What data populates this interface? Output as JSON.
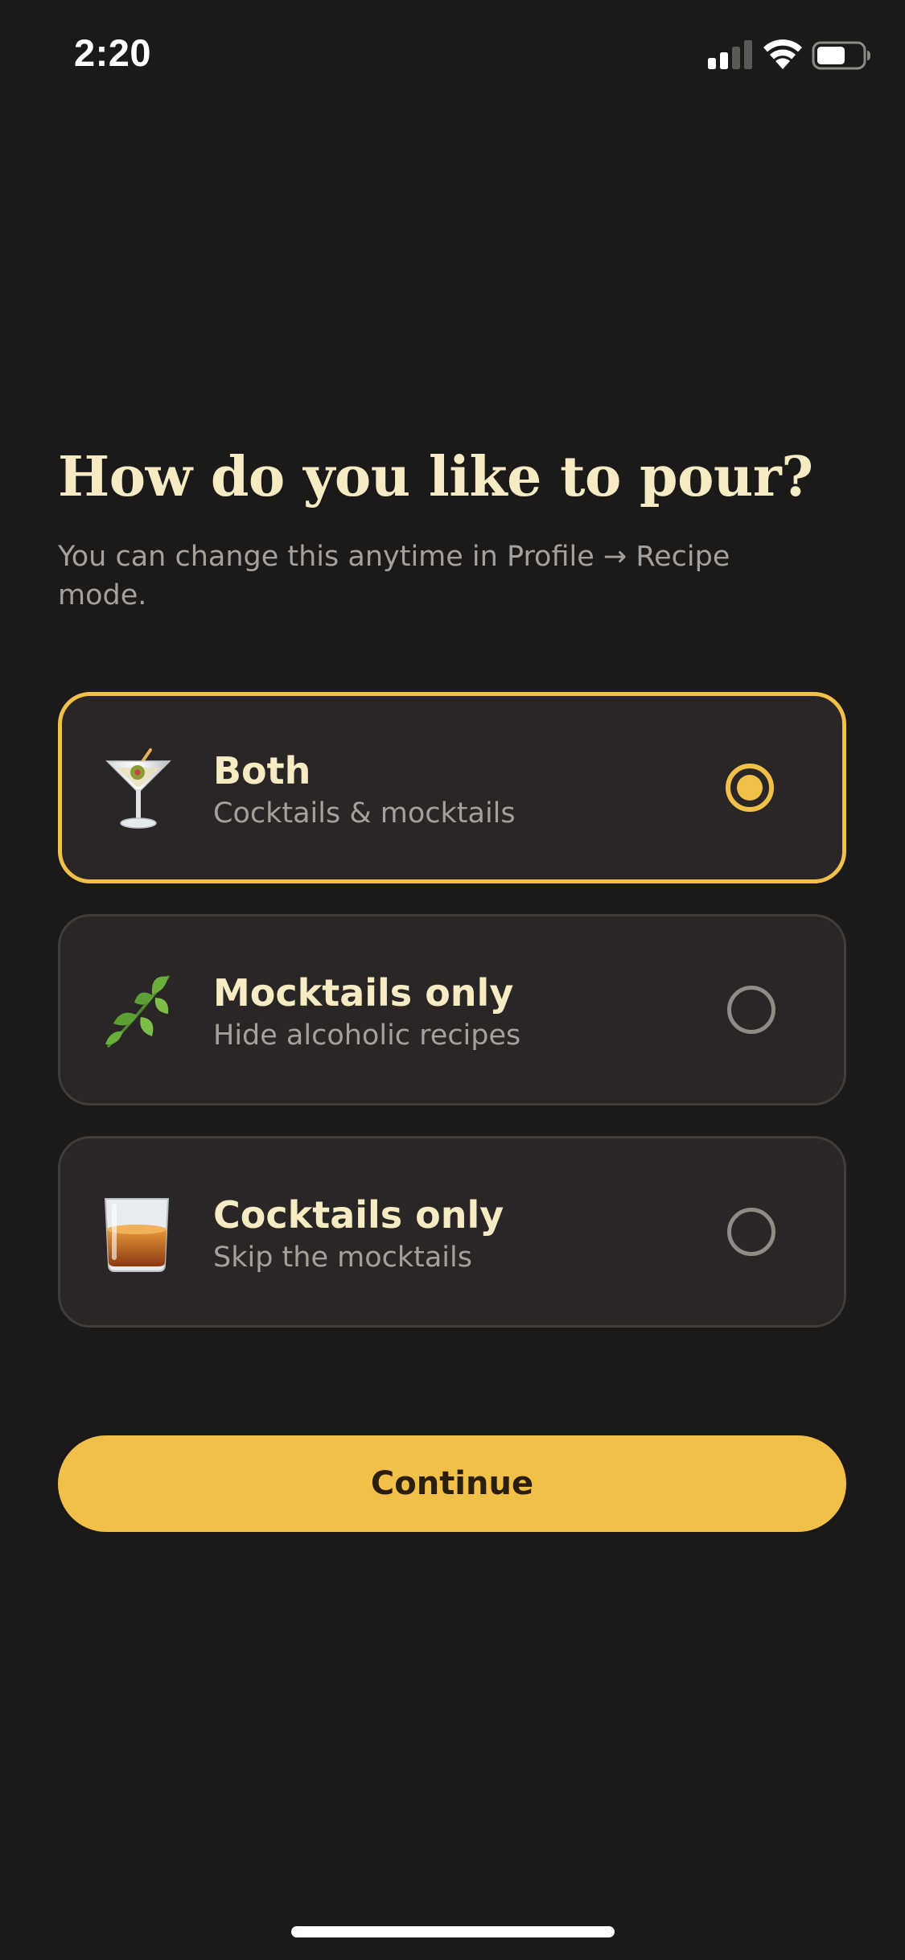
{
  "status_bar": {
    "time": "2:20",
    "signal_icon": "cellular-signal-icon",
    "wifi_icon": "wifi-icon",
    "battery_icon": "battery-icon"
  },
  "onboarding": {
    "title": "How do you like to pour?",
    "subtitle": "You can change this anytime in Profile → Recipe mode.",
    "options": [
      {
        "icon": "cocktail-glass-icon",
        "title": "Both",
        "description": "Cocktails & mocktails",
        "selected": true
      },
      {
        "icon": "herb-leaf-icon",
        "title": "Mocktails only",
        "description": "Hide alcoholic recipes",
        "selected": false
      },
      {
        "icon": "tumbler-glass-icon",
        "title": "Cocktails only",
        "description": "Skip the mocktails",
        "selected": false
      }
    ],
    "continue_label": "Continue"
  },
  "colors": {
    "background": "#1b1a19",
    "card_background": "#292625",
    "card_border": "#403d3a",
    "accent": "#f1c049",
    "title_text": "#f7ebc4",
    "secondary_text": "#a5a19a",
    "button_text": "#2a1f0e"
  }
}
